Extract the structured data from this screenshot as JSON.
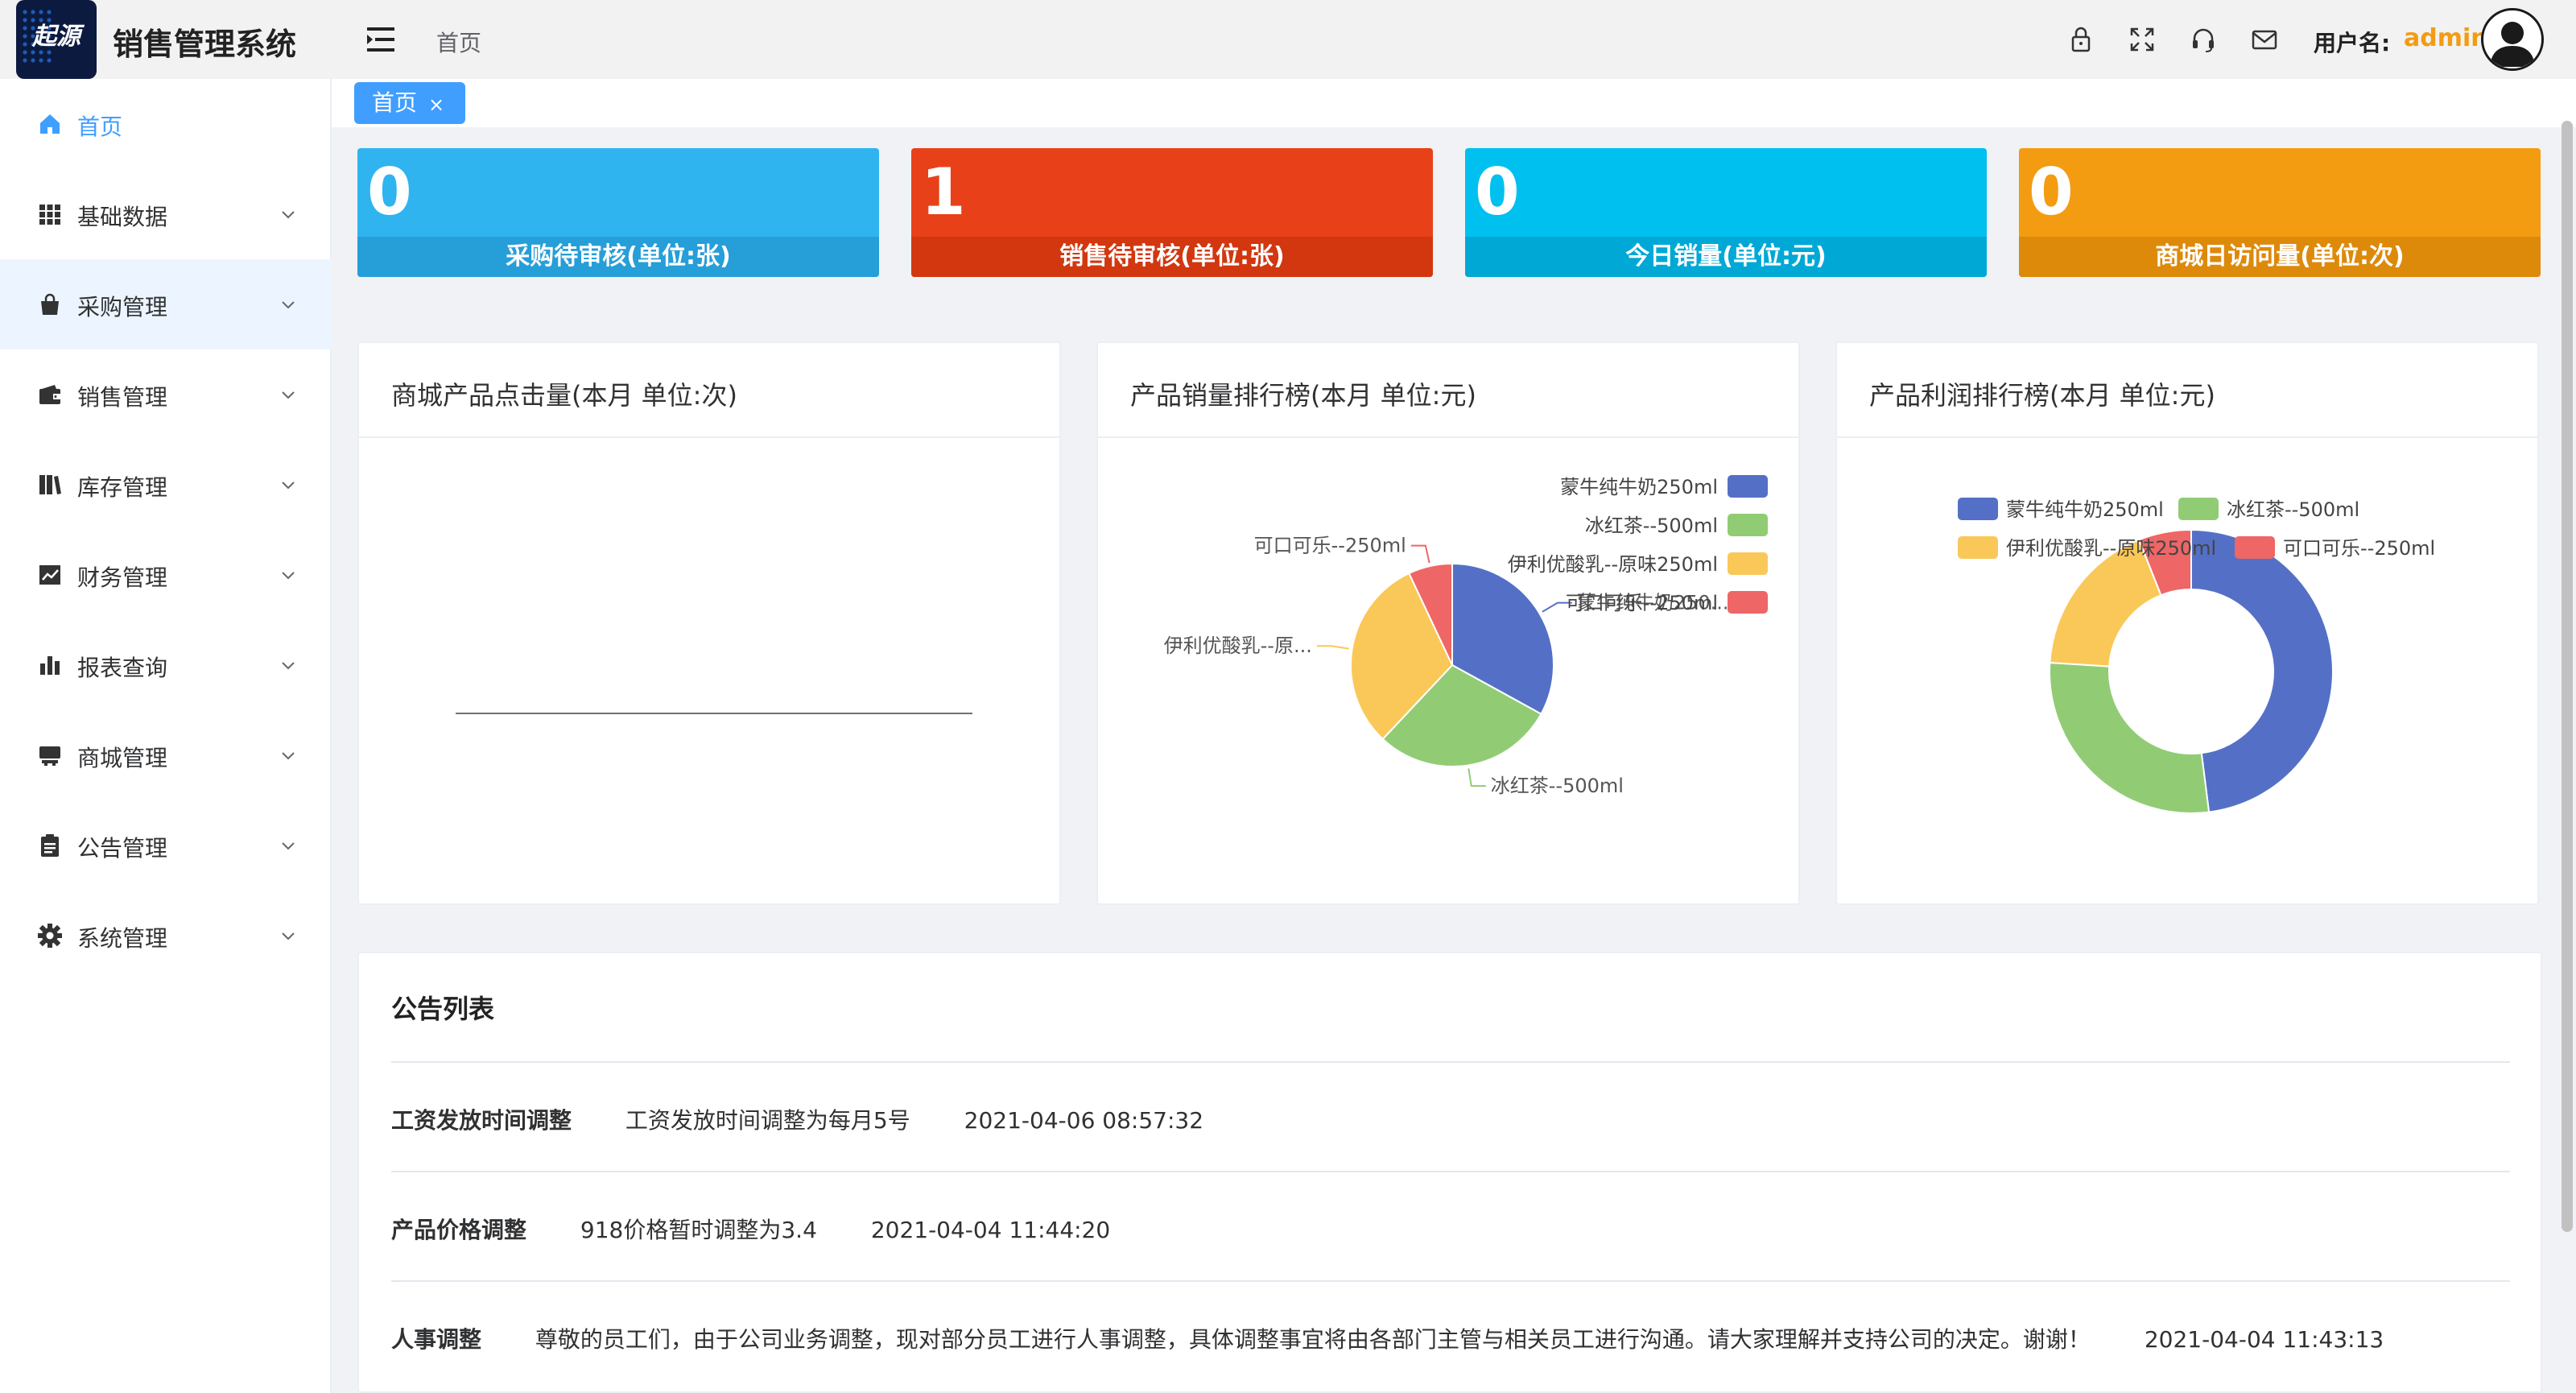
{
  "app": {
    "title": "销售管理系统",
    "logo_text": "起源",
    "breadcrumb": "首页"
  },
  "user": {
    "label": "用户名:",
    "name": "admin"
  },
  "header_icons": [
    "lock-icon",
    "fullscreen-icon",
    "headset-icon",
    "mail-icon"
  ],
  "sidebar": {
    "items": [
      {
        "label": "首页",
        "icon": "home-icon",
        "active": true
      },
      {
        "label": "基础数据",
        "icon": "grid-icon"
      },
      {
        "label": "采购管理",
        "icon": "bag-icon",
        "highlighted": true
      },
      {
        "label": "销售管理",
        "icon": "wallet-icon"
      },
      {
        "label": "库存管理",
        "icon": "books-icon"
      },
      {
        "label": "财务管理",
        "icon": "trend-chart-icon"
      },
      {
        "label": "报表查询",
        "icon": "bar-chart-icon"
      },
      {
        "label": "商城管理",
        "icon": "store-icon"
      },
      {
        "label": "公告管理",
        "icon": "clipboard-icon"
      },
      {
        "label": "系统管理",
        "icon": "gear-icon"
      }
    ]
  },
  "tabs": [
    {
      "label": "首页",
      "close": "×"
    }
  ],
  "stats": [
    {
      "value": "0",
      "label": "采购待审核(单位:张)",
      "color": "#2fb4f0",
      "band": "#269ed8"
    },
    {
      "value": "1",
      "label": "销售待审核(单位:张)",
      "color": "#e8411a",
      "band": "#d2370f"
    },
    {
      "value": "0",
      "label": "今日销量(单位:元)",
      "color": "#00c0ef",
      "band": "#00a8d6"
    },
    {
      "value": "0",
      "label": "商城日访问量(单位:次)",
      "color": "#f39c12",
      "band": "#dd8a0b"
    }
  ],
  "panels": {
    "clicks_title": "商城产品点击量(本月 单位:次)",
    "sales_title": "产品销量排行榜(本月 单位:元)",
    "profit_title": "产品利润排行榜(本月 单位:元)"
  },
  "chart_data": [
    {
      "type": "line",
      "title": "商城产品点击量(本月 单位:次)",
      "series": [],
      "values": []
    },
    {
      "type": "pie",
      "title": "产品销量排行榜(本月 单位:元)",
      "categories": [
        "蒙牛纯牛奶250ml",
        "冰红茶--500ml",
        "伊利优酸乳--原味250ml",
        "可口可乐--250ml"
      ],
      "values": [
        33,
        29,
        31,
        7
      ],
      "colors": [
        "#5470c6",
        "#91cc75",
        "#fac858",
        "#ee6666"
      ],
      "slice_labels": [
        "蒙牛纯牛奶250...",
        "冰红茶--500ml",
        "伊利优酸乳--原...",
        "可口可乐--250ml"
      ],
      "legend": "right"
    },
    {
      "type": "pie",
      "title": "产品利润排行榜(本月 单位:元)",
      "categories": [
        "蒙牛纯牛奶250ml",
        "冰红茶--500ml",
        "伊利优酸乳--原味250ml",
        "可口可乐--250ml"
      ],
      "values": [
        48,
        28,
        18,
        6
      ],
      "colors": [
        "#5470c6",
        "#91cc75",
        "#fac858",
        "#ee6666"
      ],
      "legend": "top"
    }
  ],
  "notices": {
    "title": "公告列表",
    "items": [
      {
        "title": "工资发放时间调整",
        "body": "工资发放时间调整为每月5号",
        "time": "2021-04-06 08:57:32"
      },
      {
        "title": "产品价格调整",
        "body": "918价格暂时调整为3.4",
        "time": "2021-04-04 11:44:20"
      },
      {
        "title": "人事调整",
        "body": "尊敬的员工们，由于公司业务调整，现对部分员工进行人事调整，具体调整事宜将由各部门主管与相关员工进行沟通。请大家理解并支持公司的决定。谢谢！",
        "time": "2021-04-04 11:43:13"
      }
    ]
  }
}
